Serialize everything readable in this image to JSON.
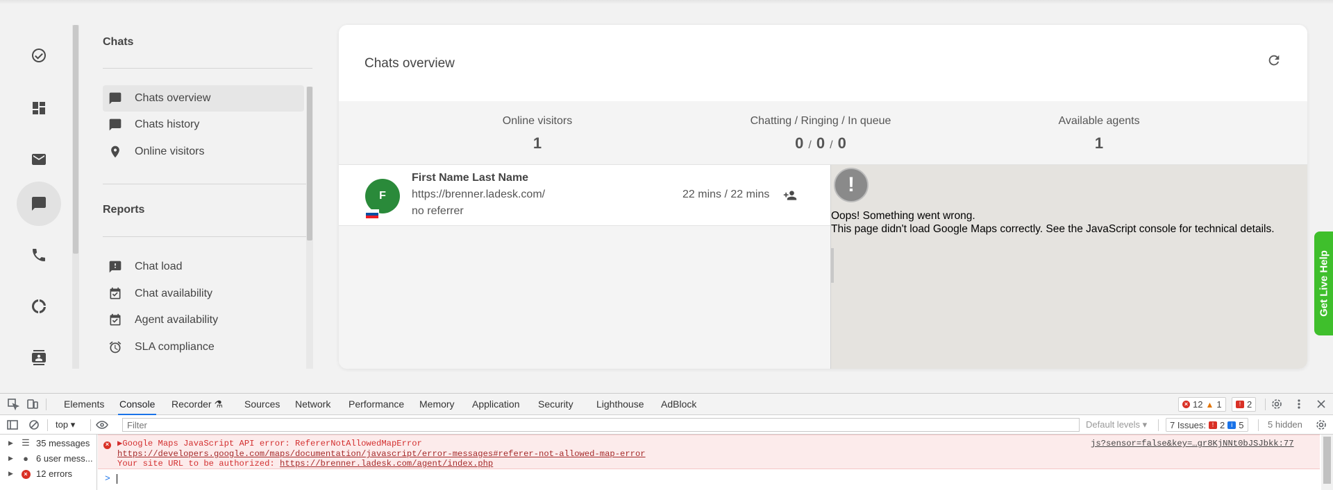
{
  "subnav": {
    "section1_title": "Chats",
    "items1": [
      {
        "label": "Chats overview",
        "icon": "chat-bubble-icon"
      },
      {
        "label": "Chats history",
        "icon": "chat-bubble-icon"
      },
      {
        "label": "Online visitors",
        "icon": "map-pin-icon"
      }
    ],
    "section2_title": "Reports",
    "items2": [
      {
        "label": "Chat load",
        "icon": "chat-alert-icon"
      },
      {
        "label": "Chat availability",
        "icon": "calendar-check-icon"
      },
      {
        "label": "Agent availability",
        "icon": "calendar-check-icon"
      },
      {
        "label": "SLA compliance",
        "icon": "alarm-clock-icon"
      }
    ]
  },
  "rail": [
    "check-circle-icon",
    "dashboard-icon",
    "mail-icon",
    "chat-icon",
    "phone-icon",
    "report-circle-icon",
    "contacts-icon"
  ],
  "card": {
    "title": "Chats overview",
    "stats": {
      "online_label": "Online visitors",
      "online_value": "1",
      "chatting_label": "Chatting / Ringing / In queue",
      "chatting": "0",
      "ringing": "0",
      "queue": "0",
      "sep": "/",
      "agents_label": "Available agents",
      "agents_value": "1"
    },
    "visitor": {
      "initial": "F",
      "name": "First Name Last Name",
      "url": "https://brenner.ladesk.com/",
      "referrer": "no referrer",
      "time": "22 mins / 22 mins"
    },
    "map": {
      "error_icon": "!",
      "line1": "Oops! Something went wrong.",
      "line2": "This page didn't load Google Maps correctly. See the JavaScript console for technical details."
    }
  },
  "live_help": "Get Live Help",
  "devtools": {
    "tabs": [
      "Elements",
      "Console",
      "Recorder",
      "Sources",
      "Network",
      "Performance",
      "Memory",
      "Application",
      "Security",
      "Lighthouse",
      "AdBlock"
    ],
    "active_tab": "Console",
    "error_count": "12",
    "warn_count": "1",
    "issue_badge_count": "2",
    "context": "top",
    "filter_placeholder": "Filter",
    "levels": "Default levels",
    "issues_label": "7 Issues:",
    "issues_errors": "2",
    "issues_info": "5",
    "hidden": "5 hidden",
    "sidebar": [
      {
        "label": "35 messages",
        "icon": "list-icon"
      },
      {
        "label": "6 user mess...",
        "icon": "user-icon"
      },
      {
        "label": "12 errors",
        "icon": "error-icon"
      }
    ],
    "error": {
      "line1": "Google Maps JavaScript API error: RefererNotAllowedMapError",
      "link1": "https://developers.google.com/maps/documentation/javascript/error-messages#referer-not-allowed-map-error",
      "line3_prefix": "Your site URL to be authorized: ",
      "link3": "https://brenner.ladesk.com/agent/index.php",
      "source": "js?sensor=false&key=…gr8KjNNt0bJSJbkk:77"
    },
    "prompt": ">"
  },
  "colors": {
    "avatar": "#2a8a3a",
    "live_help": "#3fbf2c",
    "error_bg": "#fcebeb",
    "error_text": "#d32f2f",
    "devtools_accent": "#1a73e8"
  }
}
